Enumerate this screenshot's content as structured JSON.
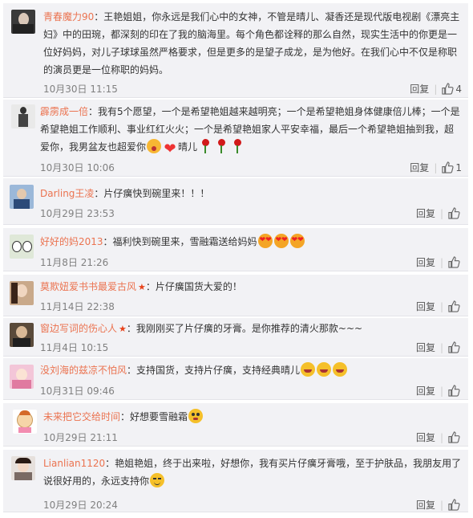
{
  "reply_label": "回复",
  "comments": [
    {
      "name": "青春魔力90",
      "text": "：王艳姐姐，你永远是我们心中的女神，不管是晴儿、凝香还是现代版电视剧《漂亮主妇》中的田琬，都深刻的印在了我的脑海里。每个角色都诠释的那么自然，现实生活中的你更是一位好妈妈，对儿子球球虽然严格要求，但是更多的是望子成龙，是为他好。在我们心中不仅是称职的演员更是一位称职的妈妈。",
      "time": "10月30日 11:15",
      "likes": "4"
    },
    {
      "name": "霹雳成一倍",
      "text": "：我有5个愿望，一个是希望艳姐越来越明亮；一个是希望艳姐身体健康倍儿棒；一个是希望艳姐工作顺利、事业红红火火；一个是希望艳姐家人平安幸福，最后一个希望艳姐抽到我，超爱你，我男盆友也超爱你",
      "text2": "晴儿",
      "time": "10月30日 10:06",
      "likes": "1"
    },
    {
      "name": "Darling王凌",
      "text": "：片仔癀快到碗里来！！！",
      "time": "10月29日 23:53",
      "likes": ""
    },
    {
      "name": "好好的妈2013",
      "text": "：福利快到碗里来，雪融霜送给妈妈",
      "time": "11月8日 21:26",
      "likes": ""
    },
    {
      "name": "莫欺妞爱书书最爱古风",
      "text": "：片仔癀国货大爱的！",
      "time": "11月14日 22:38",
      "likes": ""
    },
    {
      "name": "窗边写词的伤心人",
      "text": "：我刚刚买了片仔癀的牙膏。是你推荐的清火那款~~~",
      "time": "11月4日 10:15",
      "likes": ""
    },
    {
      "name": "没刘海的兹凉不怕风",
      "text": "：支持国货，支持片仔癀，支持经典晴儿",
      "time": "10月31日 09:46",
      "likes": ""
    },
    {
      "name": "未来把它交给时间",
      "text": "：好想要雪融霜",
      "time": "10月29日 21:11",
      "likes": ""
    },
    {
      "name": "Lianlian1120",
      "text": "：艳姐艳姐，终于出来啦，好想你，我有买片仔癀牙膏哦，至于护肤品，我朋友用了说很好用的，永远支持你",
      "time": "10月29日 20:24",
      "likes": ""
    }
  ],
  "colors": {
    "name": "#eb7350",
    "card": "#f2f2f5",
    "time": "#808080",
    "star": "#e8431b"
  }
}
